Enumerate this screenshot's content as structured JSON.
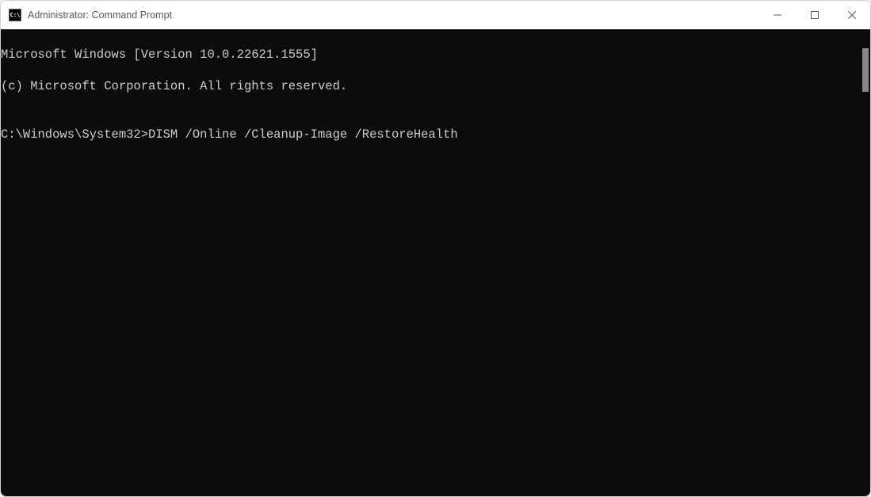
{
  "window": {
    "title": "Administrator: Command Prompt",
    "icon_label": "C:\\"
  },
  "terminal": {
    "lines": [
      "Microsoft Windows [Version 10.0.22621.1555]",
      "(c) Microsoft Corporation. All rights reserved.",
      "",
      "C:\\Windows\\System32>DISM /Online /Cleanup-Image /RestoreHealth"
    ],
    "line0": "Microsoft Windows [Version 10.0.22621.1555]",
    "line1": "(c) Microsoft Corporation. All rights reserved.",
    "line2": "",
    "line3": "C:\\Windows\\System32>DISM /Online /Cleanup-Image /RestoreHealth"
  }
}
